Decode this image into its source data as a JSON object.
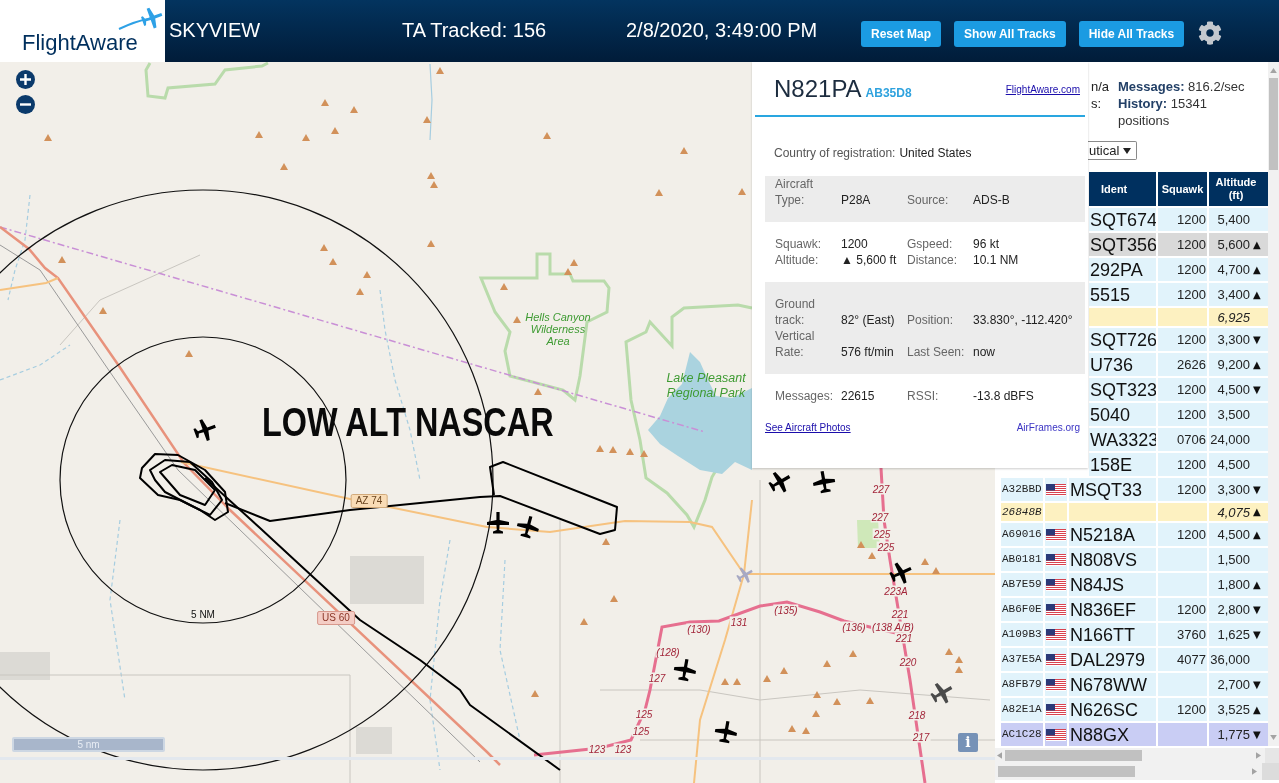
{
  "header": {
    "logo": "FlightAware",
    "title": "SKYVIEW",
    "tracked": "TA Tracked: 156",
    "datetime": "2/8/2020, 3:49:00 PM",
    "buttons": [
      "Reset Map",
      "Show All Tracks",
      "Hide All Tracks"
    ]
  },
  "map": {
    "overlay_title": "LOW ALT NASCAR",
    "ring_label": "5 NM",
    "scale_label": "5 nm",
    "info_button": "i",
    "place_labels": [
      "Hells Canyon Wilderness Area",
      "Lake Pleasant Regional Park"
    ],
    "route_shields": [
      {
        "label": "AZ 74",
        "kind": "state"
      },
      {
        "label": "US 60",
        "kind": "us"
      }
    ],
    "exit_labels": [
      "227",
      "227",
      "225",
      "225",
      "223A",
      "221",
      "221",
      "220",
      "218",
      "217",
      "(135)",
      "(136)",
      "(138 A/B)",
      "131",
      "(130)",
      "(128)",
      "127",
      "125",
      "125",
      "123",
      "123"
    ],
    "aircraft": [
      {
        "color": "#000000"
      },
      {
        "color": "#000000"
      },
      {
        "color": "#000000"
      },
      {
        "color": "#000000"
      },
      {
        "color": "#000000"
      },
      {
        "color": "#000000"
      },
      {
        "color": "#000000"
      },
      {
        "color": "#000000"
      },
      {
        "color": "#4a4a4a"
      },
      {
        "color": "#a7a9c4"
      }
    ]
  },
  "popup": {
    "ident": "N821PA",
    "hex": "AB35D8",
    "link": "FlightAware.com",
    "country_label": "Country of registration:",
    "country": "United States",
    "sections": [
      {
        "shaded": true,
        "rows": [
          {
            "label": "Aircraft Type:",
            "value": "P28A",
            "label_2": "Source:",
            "value_2": "ADS-B"
          }
        ]
      },
      {
        "shaded": false,
        "rows": [
          {
            "label": "Squawk:",
            "value": "1200",
            "label_2": "Gspeed:",
            "value_2": "96 kt"
          },
          {
            "label": "Altitude:",
            "value": "▲ 5,600 ft",
            "label_2": "Distance:",
            "value_2": "10.1 NM"
          }
        ]
      },
      {
        "shaded": true,
        "rows": [
          {
            "label": "Ground track:",
            "value": "82° (East)",
            "label_2": "Position:",
            "value_2": "33.830°, -112.420°"
          },
          {
            "label": "Vertical Rate:",
            "value": "576 ft/min",
            "label_2": "Last Seen:",
            "value_2": "now"
          }
        ]
      },
      {
        "shaded": false,
        "rows": [
          {
            "label": "Messages:",
            "value": "22615",
            "label_2": "RSSI:",
            "value_2": "-13.8 dBFS"
          }
        ]
      }
    ],
    "photos_link": "See Aircraft Photos",
    "airframes_link": "AirFrames.org"
  },
  "side_panel": {
    "partial_texts": [
      "n/a",
      "s:"
    ],
    "stats": [
      {
        "label": "Messages:",
        "value": "816.2/sec"
      },
      {
        "label": "History:",
        "value": "15341 positions"
      }
    ],
    "units_select": {
      "value": "utical"
    }
  },
  "table": {
    "columns": [
      "Ident",
      "Squawk",
      "Altitude (ft)"
    ],
    "rows": [
      {
        "ident": "SQT674",
        "squawk": "1200",
        "altitude": "5,400",
        "kind": "position",
        "selected": false,
        "highlighted": false
      },
      {
        "ident": "SQT356",
        "squawk": "1200",
        "altitude": "5,600",
        "trend": "▲",
        "kind": "position",
        "selected": true,
        "highlighted": false
      },
      {
        "ident": "292PA",
        "squawk": "1200",
        "altitude": "4,700",
        "trend": "▲",
        "kind": "position",
        "selected": false,
        "highlighted": false
      },
      {
        "ident": "5515",
        "squawk": "1200",
        "altitude": "3,400",
        "trend": "▲",
        "kind": "position",
        "selected": false,
        "highlighted": false
      },
      {
        "altitude": "6,925",
        "kind": "no_position",
        "selected": false,
        "highlighted": false
      },
      {
        "ident": "SQT726",
        "squawk": "1200",
        "altitude": "3,300",
        "trend": "▼",
        "kind": "position",
        "selected": false,
        "highlighted": false
      },
      {
        "ident": "U736",
        "squawk": "2626",
        "altitude": "9,200",
        "trend": "▲",
        "kind": "position",
        "selected": false,
        "highlighted": false
      },
      {
        "ident": "SQT323",
        "squawk": "1200",
        "altitude": "4,500",
        "trend": "▼",
        "kind": "position",
        "selected": false,
        "highlighted": false
      },
      {
        "ident": "5040",
        "squawk": "1200",
        "altitude": "3,500",
        "kind": "position",
        "selected": false,
        "highlighted": false
      },
      {
        "ident": "WA3323",
        "squawk": "0706",
        "altitude": "24,000",
        "kind": "position",
        "selected": false,
        "highlighted": false
      },
      {
        "ident": "158E",
        "squawk": "1200",
        "altitude": "4,500",
        "kind": "position",
        "selected": false,
        "highlighted": false
      },
      {
        "hex": "A32BBD",
        "flag": true,
        "ident": "MSQT33",
        "squawk": "1200",
        "altitude": "3,300",
        "trend": "▼",
        "kind": "position",
        "selected": false,
        "highlighted": false
      },
      {
        "hex": "26848B",
        "flag": false,
        "altitude": "4,075",
        "trend": "▲",
        "kind": "no_position",
        "selected": false,
        "highlighted": false
      },
      {
        "hex": "A69016",
        "flag": true,
        "ident": "N5218A",
        "squawk": "1200",
        "altitude": "4,500",
        "trend": "▲",
        "kind": "position",
        "selected": false,
        "highlighted": false
      },
      {
        "hex": "AB0181",
        "flag": true,
        "ident": "N808VS",
        "altitude": "1,500",
        "kind": "position",
        "selected": false,
        "highlighted": false
      },
      {
        "hex": "AB7E59",
        "flag": true,
        "ident": "N84JS",
        "altitude": "1,800",
        "trend": "▲",
        "kind": "position",
        "selected": false,
        "highlighted": false
      },
      {
        "hex": "AB6F0E",
        "flag": true,
        "ident": "N836EF",
        "squawk": "1200",
        "altitude": "2,800",
        "trend": "▼",
        "kind": "position",
        "selected": false,
        "highlighted": false
      },
      {
        "hex": "A109B3",
        "flag": true,
        "ident": "N166TT",
        "squawk": "3760",
        "altitude": "1,625",
        "trend": "▼",
        "kind": "position",
        "selected": false,
        "highlighted": false
      },
      {
        "hex": "A37E5A",
        "flag": true,
        "ident": "DAL2979",
        "squawk": "4077",
        "altitude": "36,000",
        "kind": "position",
        "selected": false,
        "highlighted": false
      },
      {
        "hex": "A8FB79",
        "flag": true,
        "ident": "N678WW",
        "altitude": "2,700",
        "trend": "▼",
        "kind": "position",
        "selected": false,
        "highlighted": false
      },
      {
        "hex": "A82E1A",
        "flag": true,
        "ident": "N626SC",
        "squawk": "1200",
        "altitude": "3,525",
        "trend": "▲",
        "kind": "position",
        "selected": false,
        "highlighted": false
      },
      {
        "hex": "AC1C28",
        "flag": true,
        "ident": "N88GX",
        "altitude": "1,775",
        "trend": "▼",
        "kind": "position",
        "selected": false,
        "highlighted": true
      }
    ]
  }
}
